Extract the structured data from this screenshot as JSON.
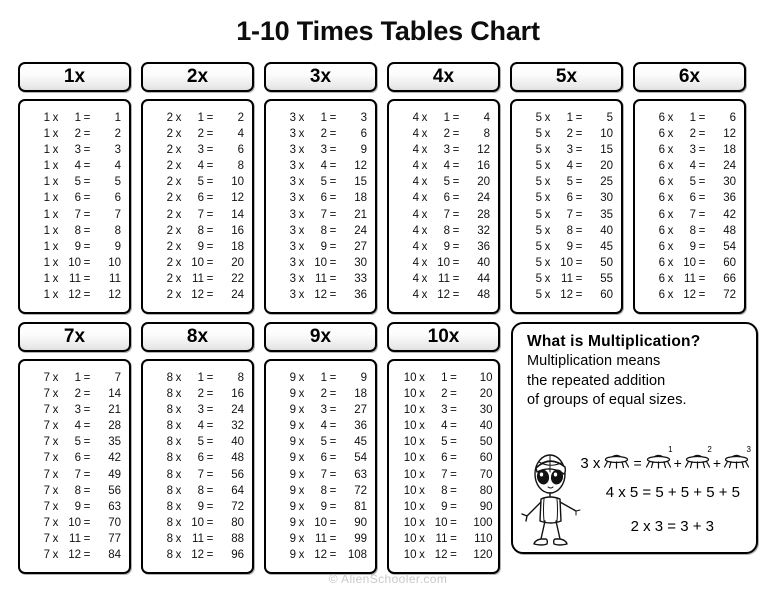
{
  "page": {
    "title": "1-10 Times Tables Chart",
    "footer": "© AlienSchooler.com",
    "background_color": "#ffffff",
    "border_color": "#000000",
    "footer_color": "#c9c9c9"
  },
  "tables": [
    {
      "header": "1x",
      "multiplier": 1,
      "rows": [
        {
          "a": "1",
          "op": "x",
          "b": "1",
          "eq": "=",
          "result": "1"
        },
        {
          "a": "1",
          "op": "x",
          "b": "2",
          "eq": "=",
          "result": "2"
        },
        {
          "a": "1",
          "op": "x",
          "b": "3",
          "eq": "=",
          "result": "3"
        },
        {
          "a": "1",
          "op": "x",
          "b": "4",
          "eq": "=",
          "result": "4"
        },
        {
          "a": "1",
          "op": "x",
          "b": "5",
          "eq": "=",
          "result": "5"
        },
        {
          "a": "1",
          "op": "x",
          "b": "6",
          "eq": "=",
          "result": "6"
        },
        {
          "a": "1",
          "op": "x",
          "b": "7",
          "eq": "=",
          "result": "7"
        },
        {
          "a": "1",
          "op": "x",
          "b": "8",
          "eq": "=",
          "result": "8"
        },
        {
          "a": "1",
          "op": "x",
          "b": "9",
          "eq": "=",
          "result": "9"
        },
        {
          "a": "1",
          "op": "x",
          "b": "10",
          "eq": "=",
          "result": "10"
        },
        {
          "a": "1",
          "op": "x",
          "b": "11",
          "eq": "=",
          "result": "11"
        },
        {
          "a": "1",
          "op": "x",
          "b": "12",
          "eq": "=",
          "result": "12"
        }
      ]
    },
    {
      "header": "2x",
      "multiplier": 2,
      "rows": [
        {
          "a": "2",
          "op": "x",
          "b": "1",
          "eq": "=",
          "result": "2"
        },
        {
          "a": "2",
          "op": "x",
          "b": "2",
          "eq": "=",
          "result": "4"
        },
        {
          "a": "2",
          "op": "x",
          "b": "3",
          "eq": "=",
          "result": "6"
        },
        {
          "a": "2",
          "op": "x",
          "b": "4",
          "eq": "=",
          "result": "8"
        },
        {
          "a": "2",
          "op": "x",
          "b": "5",
          "eq": "=",
          "result": "10"
        },
        {
          "a": "2",
          "op": "x",
          "b": "6",
          "eq": "=",
          "result": "12"
        },
        {
          "a": "2",
          "op": "x",
          "b": "7",
          "eq": "=",
          "result": "14"
        },
        {
          "a": "2",
          "op": "x",
          "b": "8",
          "eq": "=",
          "result": "16"
        },
        {
          "a": "2",
          "op": "x",
          "b": "9",
          "eq": "=",
          "result": "18"
        },
        {
          "a": "2",
          "op": "x",
          "b": "10",
          "eq": "=",
          "result": "20"
        },
        {
          "a": "2",
          "op": "x",
          "b": "11",
          "eq": "=",
          "result": "22"
        },
        {
          "a": "2",
          "op": "x",
          "b": "12",
          "eq": "=",
          "result": "24"
        }
      ]
    },
    {
      "header": "3x",
      "multiplier": 3,
      "rows": [
        {
          "a": "3",
          "op": "x",
          "b": "1",
          "eq": "=",
          "result": "3"
        },
        {
          "a": "3",
          "op": "x",
          "b": "2",
          "eq": "=",
          "result": "6"
        },
        {
          "a": "3",
          "op": "x",
          "b": "3",
          "eq": "=",
          "result": "9"
        },
        {
          "a": "3",
          "op": "x",
          "b": "4",
          "eq": "=",
          "result": "12"
        },
        {
          "a": "3",
          "op": "x",
          "b": "5",
          "eq": "=",
          "result": "15"
        },
        {
          "a": "3",
          "op": "x",
          "b": "6",
          "eq": "=",
          "result": "18"
        },
        {
          "a": "3",
          "op": "x",
          "b": "7",
          "eq": "=",
          "result": "21"
        },
        {
          "a": "3",
          "op": "x",
          "b": "8",
          "eq": "=",
          "result": "24"
        },
        {
          "a": "3",
          "op": "x",
          "b": "9",
          "eq": "=",
          "result": "27"
        },
        {
          "a": "3",
          "op": "x",
          "b": "10",
          "eq": "=",
          "result": "30"
        },
        {
          "a": "3",
          "op": "x",
          "b": "11",
          "eq": "=",
          "result": "33"
        },
        {
          "a": "3",
          "op": "x",
          "b": "12",
          "eq": "=",
          "result": "36"
        }
      ]
    },
    {
      "header": "4x",
      "multiplier": 4,
      "rows": [
        {
          "a": "4",
          "op": "x",
          "b": "1",
          "eq": "=",
          "result": "4"
        },
        {
          "a": "4",
          "op": "x",
          "b": "2",
          "eq": "=",
          "result": "8"
        },
        {
          "a": "4",
          "op": "x",
          "b": "3",
          "eq": "=",
          "result": "12"
        },
        {
          "a": "4",
          "op": "x",
          "b": "4",
          "eq": "=",
          "result": "16"
        },
        {
          "a": "4",
          "op": "x",
          "b": "5",
          "eq": "=",
          "result": "20"
        },
        {
          "a": "4",
          "op": "x",
          "b": "6",
          "eq": "=",
          "result": "24"
        },
        {
          "a": "4",
          "op": "x",
          "b": "7",
          "eq": "=",
          "result": "28"
        },
        {
          "a": "4",
          "op": "x",
          "b": "8",
          "eq": "=",
          "result": "32"
        },
        {
          "a": "4",
          "op": "x",
          "b": "9",
          "eq": "=",
          "result": "36"
        },
        {
          "a": "4",
          "op": "x",
          "b": "10",
          "eq": "=",
          "result": "40"
        },
        {
          "a": "4",
          "op": "x",
          "b": "11",
          "eq": "=",
          "result": "44"
        },
        {
          "a": "4",
          "op": "x",
          "b": "12",
          "eq": "=",
          "result": "48"
        }
      ]
    },
    {
      "header": "5x",
      "multiplier": 5,
      "rows": [
        {
          "a": "5",
          "op": "x",
          "b": "1",
          "eq": "=",
          "result": "5"
        },
        {
          "a": "5",
          "op": "x",
          "b": "2",
          "eq": "=",
          "result": "10"
        },
        {
          "a": "5",
          "op": "x",
          "b": "3",
          "eq": "=",
          "result": "15"
        },
        {
          "a": "5",
          "op": "x",
          "b": "4",
          "eq": "=",
          "result": "20"
        },
        {
          "a": "5",
          "op": "x",
          "b": "5",
          "eq": "=",
          "result": "25"
        },
        {
          "a": "5",
          "op": "x",
          "b": "6",
          "eq": "=",
          "result": "30"
        },
        {
          "a": "5",
          "op": "x",
          "b": "7",
          "eq": "=",
          "result": "35"
        },
        {
          "a": "5",
          "op": "x",
          "b": "8",
          "eq": "=",
          "result": "40"
        },
        {
          "a": "5",
          "op": "x",
          "b": "9",
          "eq": "=",
          "result": "45"
        },
        {
          "a": "5",
          "op": "x",
          "b": "10",
          "eq": "=",
          "result": "50"
        },
        {
          "a": "5",
          "op": "x",
          "b": "11",
          "eq": "=",
          "result": "55"
        },
        {
          "a": "5",
          "op": "x",
          "b": "12",
          "eq": "=",
          "result": "60"
        }
      ]
    },
    {
      "header": "6x",
      "multiplier": 6,
      "rows": [
        {
          "a": "6",
          "op": "x",
          "b": "1",
          "eq": "=",
          "result": "6"
        },
        {
          "a": "6",
          "op": "x",
          "b": "2",
          "eq": "=",
          "result": "12"
        },
        {
          "a": "6",
          "op": "x",
          "b": "3",
          "eq": "=",
          "result": "18"
        },
        {
          "a": "6",
          "op": "x",
          "b": "4",
          "eq": "=",
          "result": "24"
        },
        {
          "a": "6",
          "op": "x",
          "b": "5",
          "eq": "=",
          "result": "30"
        },
        {
          "a": "6",
          "op": "x",
          "b": "6",
          "eq": "=",
          "result": "36"
        },
        {
          "a": "6",
          "op": "x",
          "b": "7",
          "eq": "=",
          "result": "42"
        },
        {
          "a": "6",
          "op": "x",
          "b": "8",
          "eq": "=",
          "result": "48"
        },
        {
          "a": "6",
          "op": "x",
          "b": "9",
          "eq": "=",
          "result": "54"
        },
        {
          "a": "6",
          "op": "x",
          "b": "10",
          "eq": "=",
          "result": "60"
        },
        {
          "a": "6",
          "op": "x",
          "b": "11",
          "eq": "=",
          "result": "66"
        },
        {
          "a": "6",
          "op": "x",
          "b": "12",
          "eq": "=",
          "result": "72"
        }
      ]
    },
    {
      "header": "7x",
      "multiplier": 7,
      "rows": [
        {
          "a": "7",
          "op": "x",
          "b": "1",
          "eq": "=",
          "result": "7"
        },
        {
          "a": "7",
          "op": "x",
          "b": "2",
          "eq": "=",
          "result": "14"
        },
        {
          "a": "7",
          "op": "x",
          "b": "3",
          "eq": "=",
          "result": "21"
        },
        {
          "a": "7",
          "op": "x",
          "b": "4",
          "eq": "=",
          "result": "28"
        },
        {
          "a": "7",
          "op": "x",
          "b": "5",
          "eq": "=",
          "result": "35"
        },
        {
          "a": "7",
          "op": "x",
          "b": "6",
          "eq": "=",
          "result": "42"
        },
        {
          "a": "7",
          "op": "x",
          "b": "7",
          "eq": "=",
          "result": "49"
        },
        {
          "a": "7",
          "op": "x",
          "b": "8",
          "eq": "=",
          "result": "56"
        },
        {
          "a": "7",
          "op": "x",
          "b": "9",
          "eq": "=",
          "result": "63"
        },
        {
          "a": "7",
          "op": "x",
          "b": "10",
          "eq": "=",
          "result": "70"
        },
        {
          "a": "7",
          "op": "x",
          "b": "11",
          "eq": "=",
          "result": "77"
        },
        {
          "a": "7",
          "op": "x",
          "b": "12",
          "eq": "=",
          "result": "84"
        }
      ]
    },
    {
      "header": "8x",
      "multiplier": 8,
      "rows": [
        {
          "a": "8",
          "op": "x",
          "b": "1",
          "eq": "=",
          "result": "8"
        },
        {
          "a": "8",
          "op": "x",
          "b": "2",
          "eq": "=",
          "result": "16"
        },
        {
          "a": "8",
          "op": "x",
          "b": "3",
          "eq": "=",
          "result": "24"
        },
        {
          "a": "8",
          "op": "x",
          "b": "4",
          "eq": "=",
          "result": "32"
        },
        {
          "a": "8",
          "op": "x",
          "b": "5",
          "eq": "=",
          "result": "40"
        },
        {
          "a": "8",
          "op": "x",
          "b": "6",
          "eq": "=",
          "result": "48"
        },
        {
          "a": "8",
          "op": "x",
          "b": "7",
          "eq": "=",
          "result": "56"
        },
        {
          "a": "8",
          "op": "x",
          "b": "8",
          "eq": "=",
          "result": "64"
        },
        {
          "a": "8",
          "op": "x",
          "b": "9",
          "eq": "=",
          "result": "72"
        },
        {
          "a": "8",
          "op": "x",
          "b": "10",
          "eq": "=",
          "result": "80"
        },
        {
          "a": "8",
          "op": "x",
          "b": "11",
          "eq": "=",
          "result": "88"
        },
        {
          "a": "8",
          "op": "x",
          "b": "12",
          "eq": "=",
          "result": "96"
        }
      ]
    },
    {
      "header": "9x",
      "multiplier": 9,
      "rows": [
        {
          "a": "9",
          "op": "x",
          "b": "1",
          "eq": "=",
          "result": "9"
        },
        {
          "a": "9",
          "op": "x",
          "b": "2",
          "eq": "=",
          "result": "18"
        },
        {
          "a": "9",
          "op": "x",
          "b": "3",
          "eq": "=",
          "result": "27"
        },
        {
          "a": "9",
          "op": "x",
          "b": "4",
          "eq": "=",
          "result": "36"
        },
        {
          "a": "9",
          "op": "x",
          "b": "5",
          "eq": "=",
          "result": "45"
        },
        {
          "a": "9",
          "op": "x",
          "b": "6",
          "eq": "=",
          "result": "54"
        },
        {
          "a": "9",
          "op": "x",
          "b": "7",
          "eq": "=",
          "result": "63"
        },
        {
          "a": "9",
          "op": "x",
          "b": "8",
          "eq": "=",
          "result": "72"
        },
        {
          "a": "9",
          "op": "x",
          "b": "9",
          "eq": "=",
          "result": "81"
        },
        {
          "a": "9",
          "op": "x",
          "b": "10",
          "eq": "=",
          "result": "90"
        },
        {
          "a": "9",
          "op": "x",
          "b": "11",
          "eq": "=",
          "result": "99"
        },
        {
          "a": "9",
          "op": "x",
          "b": "12",
          "eq": "=",
          "result": "108"
        }
      ]
    },
    {
      "header": "10x",
      "multiplier": 10,
      "rows": [
        {
          "a": "10",
          "op": "x",
          "b": "1",
          "eq": "=",
          "result": "10"
        },
        {
          "a": "10",
          "op": "x",
          "b": "2",
          "eq": "=",
          "result": "20"
        },
        {
          "a": "10",
          "op": "x",
          "b": "3",
          "eq": "=",
          "result": "30"
        },
        {
          "a": "10",
          "op": "x",
          "b": "4",
          "eq": "=",
          "result": "40"
        },
        {
          "a": "10",
          "op": "x",
          "b": "5",
          "eq": "=",
          "result": "50"
        },
        {
          "a": "10",
          "op": "x",
          "b": "6",
          "eq": "=",
          "result": "60"
        },
        {
          "a": "10",
          "op": "x",
          "b": "7",
          "eq": "=",
          "result": "70"
        },
        {
          "a": "10",
          "op": "x",
          "b": "8",
          "eq": "=",
          "result": "80"
        },
        {
          "a": "10",
          "op": "x",
          "b": "9",
          "eq": "=",
          "result": "90"
        },
        {
          "a": "10",
          "op": "x",
          "b": "10",
          "eq": "=",
          "result": "100"
        },
        {
          "a": "10",
          "op": "x",
          "b": "11",
          "eq": "=",
          "result": "110"
        },
        {
          "a": "10",
          "op": "x",
          "b": "12",
          "eq": "=",
          "result": "120"
        }
      ]
    }
  ],
  "explanation": {
    "heading": "What is Multiplication?",
    "body_line1": "Multiplication means",
    "body_line2": "the repeated addition",
    "body_line3": "of groups of equal sizes.",
    "ufo_equation": {
      "lead": "3 x",
      "equals": "=",
      "plus": "+",
      "ufo_labels": [
        "1",
        "2",
        "3"
      ]
    },
    "equation2": "4 x 5 = 5 + 5 + 5 + 5",
    "equation3": "2 x 3 = 3 + 3",
    "mascot": "alien-character"
  }
}
